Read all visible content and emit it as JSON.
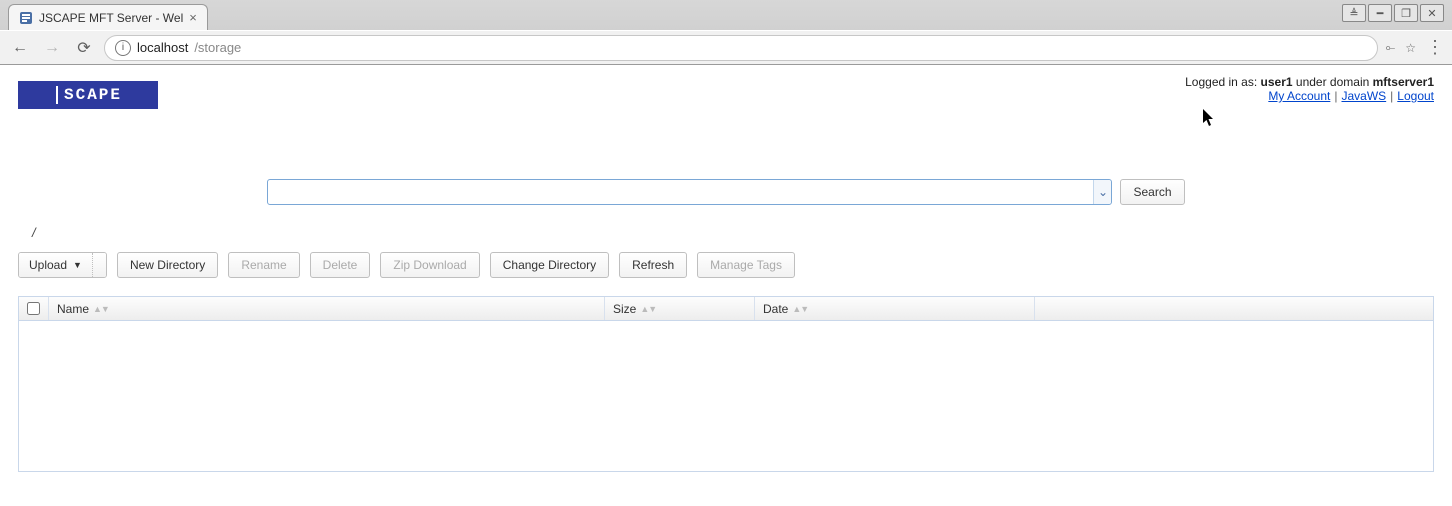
{
  "browser": {
    "tab_title": "JSCAPE MFT Server - Wel",
    "url_host": "localhost",
    "url_path": "/storage",
    "win_user_glyph": "≜",
    "win_min_glyph": "━",
    "win_max_glyph": "❐",
    "win_close_glyph": "✕",
    "back_glyph": "←",
    "forward_glyph": "→",
    "reload_glyph": "⟳",
    "key_glyph": "⟜",
    "star_glyph": "☆",
    "menu_glyph": "⋮",
    "tab_close_glyph": "×"
  },
  "header": {
    "logged_in_prefix": "Logged in as: ",
    "user": "user1",
    "domain_prefix": " under domain ",
    "domain": "mftserver1",
    "links": {
      "my_account": "My Account",
      "javaws": "JavaWS",
      "logout": "Logout"
    }
  },
  "search": {
    "value": "",
    "button": "Search",
    "trigger_glyph": "⌄"
  },
  "breadcrumb": "/",
  "toolbar": {
    "upload": "Upload",
    "upload_caret": "▼",
    "new_directory": "New Directory",
    "rename": "Rename",
    "delete": "Delete",
    "zip_download": "Zip Download",
    "change_directory": "Change Directory",
    "refresh": "Refresh",
    "manage_tags": "Manage Tags"
  },
  "grid": {
    "columns": {
      "name": "Name",
      "size": "Size",
      "date": "Date"
    },
    "sort_glyph": "▲▼",
    "rows": []
  },
  "logo_text": "SCAPE"
}
